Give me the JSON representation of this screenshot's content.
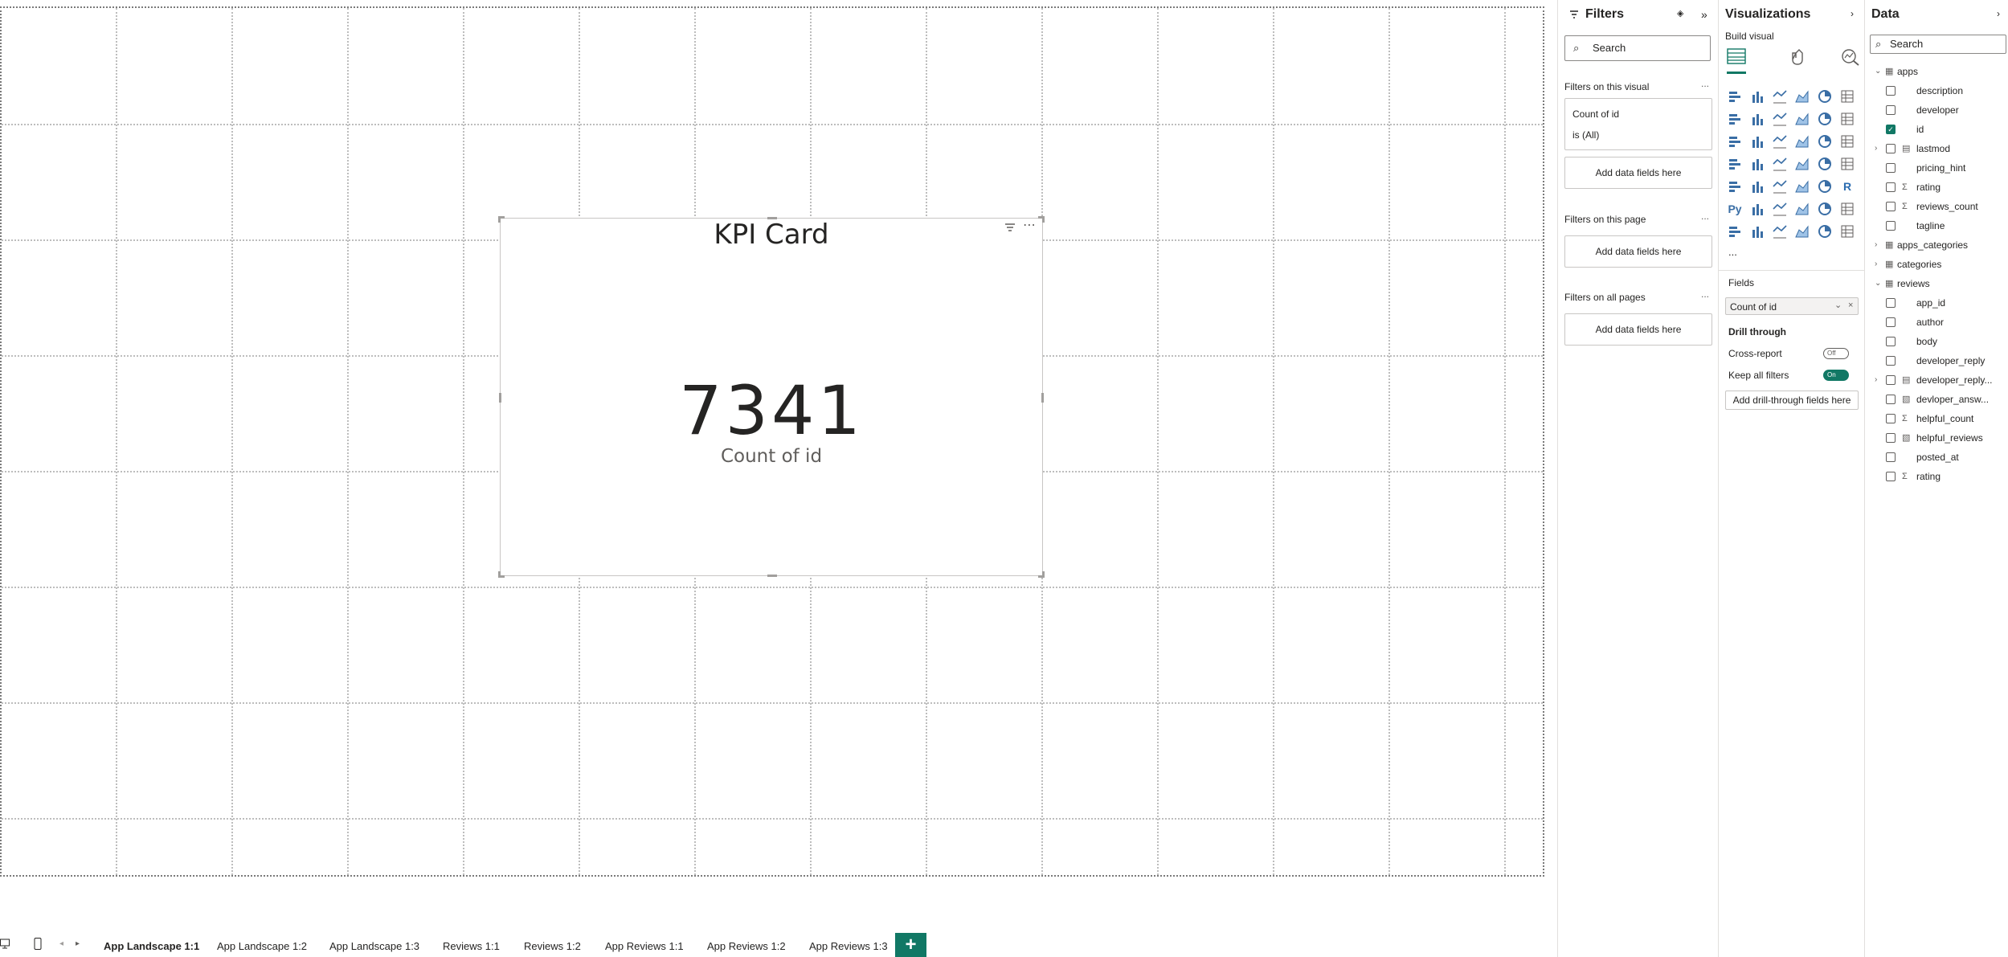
{
  "canvas": {
    "kpi": {
      "title": "KPI Card",
      "value": "7341",
      "label": "Count of id"
    }
  },
  "tabs": {
    "pages": [
      {
        "label": "App Landscape 1:1",
        "active": true
      },
      {
        "label": "App Landscape 1:2",
        "active": false
      },
      {
        "label": "App Landscape 1:3",
        "active": false
      },
      {
        "label": "Reviews 1:1",
        "active": false
      },
      {
        "label": "Reviews 1:2",
        "active": false
      },
      {
        "label": "App Reviews 1:1",
        "active": false
      },
      {
        "label": "App Reviews 1:2",
        "active": false
      },
      {
        "label": "App Reviews 1:3",
        "active": false
      }
    ],
    "add_label": "+"
  },
  "filters": {
    "title": "Filters",
    "search_placeholder": "Search",
    "on_visual_title": "Filters on this visual",
    "visual_filter": {
      "field": "Count of id",
      "condition": "is (All)"
    },
    "add_fields_label": "Add data fields here",
    "on_page_title": "Filters on this page",
    "on_all_pages_title": "Filters on all pages",
    "more": "..."
  },
  "visualizations": {
    "title": "Visualizations",
    "build_visual": "Build visual",
    "more": "...",
    "fields_title": "Fields",
    "field_well_value": "Count of id",
    "drill_through_title": "Drill through",
    "cross_report_label": "Cross-report",
    "cross_report_state": "Off",
    "keep_filters_label": "Keep all filters",
    "keep_filters_state": "On",
    "add_drillthrough_label": "Add drill-through fields here",
    "py_label": "Py",
    "r_label": "R"
  },
  "data": {
    "title": "Data",
    "search_placeholder": "Search",
    "tables": [
      {
        "name": "apps",
        "expanded": true,
        "fields": [
          {
            "name": "description",
            "type": "text",
            "checked": false
          },
          {
            "name": "developer",
            "type": "text",
            "checked": false
          },
          {
            "name": "id",
            "type": "text",
            "checked": true
          },
          {
            "name": "lastmod",
            "type": "hierarchy",
            "checked": false
          },
          {
            "name": "pricing_hint",
            "type": "text",
            "checked": false
          },
          {
            "name": "rating",
            "type": "sum",
            "checked": false
          },
          {
            "name": "reviews_count",
            "type": "sum",
            "checked": false
          },
          {
            "name": "tagline",
            "type": "text",
            "checked": false
          }
        ]
      },
      {
        "name": "apps_categories",
        "expanded": false
      },
      {
        "name": "categories",
        "expanded": false
      },
      {
        "name": "reviews",
        "expanded": true,
        "fields": [
          {
            "name": "app_id",
            "type": "text",
            "checked": false
          },
          {
            "name": "author",
            "type": "text",
            "checked": false
          },
          {
            "name": "body",
            "type": "text",
            "checked": false
          },
          {
            "name": "developer_reply",
            "type": "text",
            "checked": false
          },
          {
            "name": "developer_reply...",
            "type": "hierarchy",
            "checked": false
          },
          {
            "name": "devloper_answ...",
            "type": "calc",
            "checked": false
          },
          {
            "name": "helpful_count",
            "type": "sum",
            "checked": false
          },
          {
            "name": "helpful_reviews",
            "type": "calc",
            "checked": false
          },
          {
            "name": "posted_at",
            "type": "text",
            "checked": false
          },
          {
            "name": "rating",
            "type": "sum",
            "checked": false
          }
        ]
      }
    ]
  },
  "colors": {
    "accent": "#117865",
    "border": "#c8c6c4",
    "text": "#252423"
  }
}
